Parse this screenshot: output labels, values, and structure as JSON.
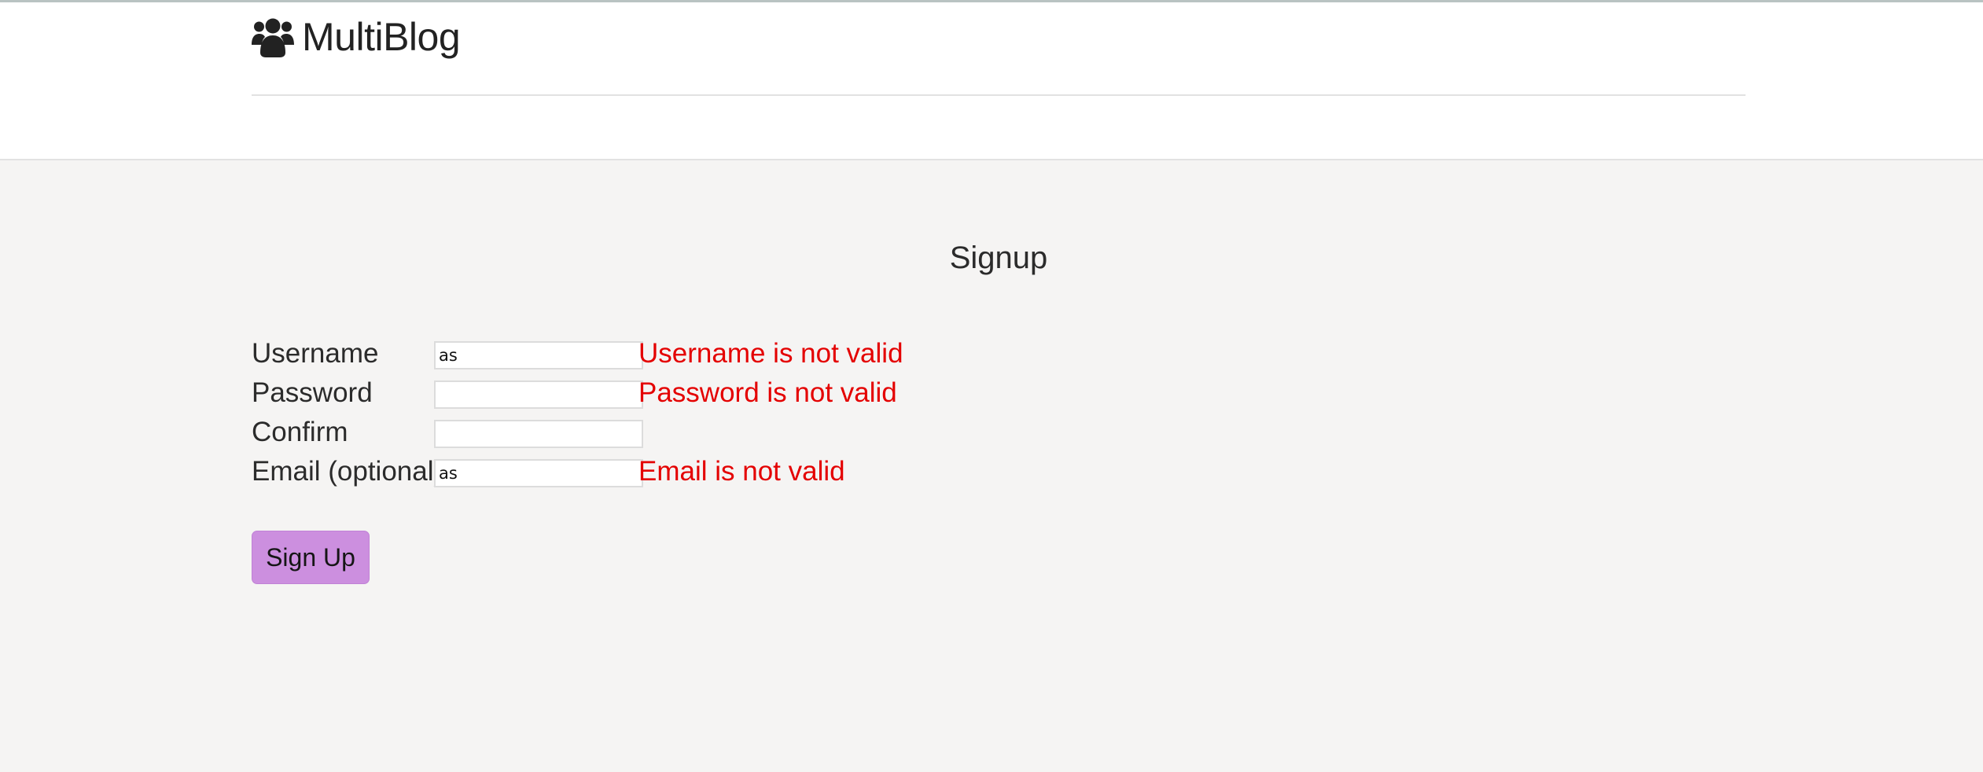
{
  "header": {
    "brand_name": "MultiBlog",
    "brand_icon": "users-icon"
  },
  "main": {
    "title": "Signup",
    "form": {
      "fields": [
        {
          "label": "Username",
          "value": "as",
          "error": "Username is not valid"
        },
        {
          "label": "Password",
          "value": "",
          "error": "Password is not valid"
        },
        {
          "label": "Confirm",
          "value": "",
          "error": ""
        },
        {
          "label": "Email (optional)",
          "value": "as",
          "error": "Email is not valid"
        }
      ],
      "submit_label": "Sign Up"
    }
  },
  "colors": {
    "error": "#e40000",
    "button": "#cc8fdf",
    "page_background": "#f5f4f3",
    "header_background": "#ffffff"
  }
}
